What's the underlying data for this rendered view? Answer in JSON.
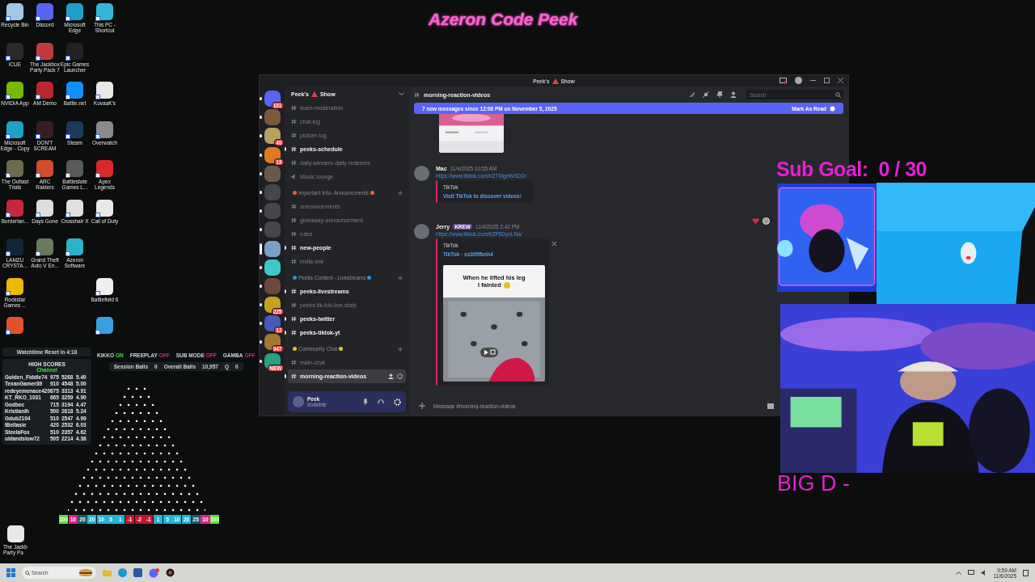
{
  "stream_title": "Azeron Code Peek",
  "desktop_icon_rows": [
    [
      {
        "kind": "app",
        "label": "Recycle Bin",
        "color": "#9fc9e8"
      },
      {
        "kind": "app",
        "label": "Discord",
        "color": "#5865f2"
      },
      {
        "kind": "app",
        "label": "Microsoft Edge",
        "color": "#1fa0c8"
      },
      {
        "kind": "app",
        "label": "This PC - Shortcut",
        "color": "#33b7d6"
      }
    ],
    [
      {
        "kind": "app",
        "label": "iCUE",
        "color": "#2a2a2a"
      },
      {
        "kind": "app",
        "label": "The Jackbox Party Pack 7",
        "color": "#c23a3a"
      },
      {
        "kind": "app",
        "label": "Epic Games Launcher",
        "color": "#222222"
      },
      {
        "kind": "blank"
      }
    ],
    [
      {
        "kind": "app",
        "label": "NVIDIA App",
        "color": "#76b900"
      },
      {
        "kind": "app",
        "label": "AM Demo",
        "color": "#b8282e"
      },
      {
        "kind": "app",
        "label": "Battle.net",
        "color": "#148eff"
      },
      {
        "kind": "app",
        "label": "KovaaK's",
        "color": "#e8e8e8"
      }
    ],
    [
      {
        "kind": "app",
        "label": "Microsoft Edge - Copy",
        "color": "#1fa0c8"
      },
      {
        "kind": "app",
        "label": "DON'T SCREAM",
        "color": "#3a1d22"
      },
      {
        "kind": "app",
        "label": "Steam",
        "color": "#1b3a5c"
      },
      {
        "kind": "app",
        "label": "Overwatch",
        "color": "#8a8a8a"
      }
    ],
    [
      {
        "kind": "app",
        "label": "The Outlast Trials",
        "color": "#6b6a4a"
      },
      {
        "kind": "app",
        "label": "ARC Raiders",
        "color": "#d24b2a"
      },
      {
        "kind": "app",
        "label": "Battlestate Games L...",
        "color": "#5a5a5a"
      },
      {
        "kind": "app",
        "label": "Apex Legends",
        "color": "#da292a"
      }
    ],
    [
      {
        "kind": "app",
        "label": "Borderlan...",
        "color": "#c4283a"
      },
      {
        "kind": "app",
        "label": "Days Gone",
        "color": "#dddddd"
      },
      {
        "kind": "app",
        "label": "Crosshair X",
        "color": "#e0e0e0"
      },
      {
        "kind": "app",
        "label": "Call of Duty",
        "color": "#e8e8e8"
      }
    ],
    [
      {
        "kind": "app",
        "label": "LAMZU CRYSTA...",
        "color": "#12263a"
      },
      {
        "kind": "app",
        "label": "Grand Theft Auto V En...",
        "color": "#6a7a5a"
      },
      {
        "kind": "app",
        "label": "Azeron Software",
        "color": "#2bb3c9"
      },
      {
        "kind": "blank"
      }
    ],
    [
      {
        "kind": "app",
        "label": "Rockstar Games ...",
        "color": "#f2b705"
      },
      {
        "kind": "blank"
      },
      {
        "kind": "blank"
      },
      {
        "kind": "app",
        "label": "Battlefield 6",
        "color": "#eeeeee"
      }
    ],
    [
      {
        "kind": "app",
        "color": "#e3502a"
      },
      {
        "kind": "blank"
      },
      {
        "kind": "blank"
      },
      {
        "kind": "app",
        "color": "#39a0e0"
      }
    ]
  ],
  "corner_icon": {
    "label": "The Jackb Party Pa"
  },
  "plinko": {
    "watchtime": "Watchtime Reset in 4:18",
    "flags": [
      {
        "label": "KIKKO",
        "value": "ON",
        "on": true
      },
      {
        "label": "FREEPLAY",
        "value": "OFF",
        "on": false
      },
      {
        "label": "SUB MODE",
        "value": "OFF",
        "on": false
      },
      {
        "label": "GAMBA",
        "value": "OFF",
        "on": false
      }
    ],
    "stats": [
      {
        "label": "Session Balls",
        "value": "0"
      },
      {
        "label": "Overall Balls",
        "value": "10,957"
      },
      {
        "label": "Q",
        "value": "0"
      }
    ],
    "high_scores": {
      "title": "HIGH SCORES",
      "subtitle": "Channel",
      "rows": [
        [
          "Golden_Fiddle74",
          "975",
          "5268",
          "5.40"
        ],
        [
          "TexanGamer89",
          "910",
          "4548",
          "5.00"
        ],
        [
          "redeyemenace420",
          "675",
          "3313",
          "4.91"
        ],
        [
          "KT_RKO_1031",
          "665",
          "3259",
          "4.90"
        ],
        [
          "Godbec",
          "715",
          "3194",
          "4.47"
        ],
        [
          "KristianIh",
          "500",
          "2618",
          "5.24"
        ],
        [
          "Gdub2104",
          "510",
          "2547",
          "4.99"
        ],
        [
          "IBellasie",
          "420",
          "2532",
          "6.03"
        ],
        [
          "SteelaFox",
          "510",
          "2357",
          "4.62"
        ],
        [
          "oldandslow72",
          "505",
          "2214",
          "4.38"
        ]
      ]
    },
    "bins": [
      {
        "value": "100",
        "color": "#5fe03a"
      },
      {
        "value": "10",
        "color": "#e0238c"
      },
      {
        "value": "20",
        "color": "#1d5a6e"
      },
      {
        "value": "20",
        "color": "#22b5d8"
      },
      {
        "value": "10",
        "color": "#22b5d8"
      },
      {
        "value": "5",
        "color": "#22b5d8"
      },
      {
        "value": "1",
        "color": "#22b5d8"
      },
      {
        "value": "-1",
        "color": "#c4162e"
      },
      {
        "value": "-2",
        "color": "#c4162e"
      },
      {
        "value": "-1",
        "color": "#c4162e"
      },
      {
        "value": "1",
        "color": "#22b5d8"
      },
      {
        "value": "5",
        "color": "#22b5d8"
      },
      {
        "value": "10",
        "color": "#22b5d8"
      },
      {
        "value": "20",
        "color": "#22b5d8"
      },
      {
        "value": "25",
        "color": "#1d5a6e"
      },
      {
        "value": "10",
        "color": "#e0238c"
      },
      {
        "value": "100",
        "color": "#5fe03a"
      }
    ]
  },
  "discord": {
    "window_title": [
      "Peek's",
      "Show"
    ],
    "servers": [
      {
        "badge": "101",
        "color": "#5865f2",
        "selected": false
      },
      {
        "color": "#7a5a3a",
        "selected": false
      },
      {
        "badge": "40",
        "color": "#b8a060",
        "selected": false
      },
      {
        "badge": "19",
        "color": "#e07a20",
        "selected": false
      },
      {
        "color": "#6a5a4a",
        "selected": false
      },
      {
        "color": "#45464c",
        "selected": false
      },
      {
        "color": "#45464c",
        "selected": false
      },
      {
        "color": "#45464c",
        "selected": false
      },
      {
        "color": "#7aa0c8",
        "selected": true
      },
      {
        "color": "#3ec8c8",
        "selected": false
      },
      {
        "color": "#6a4a3a",
        "selected": false
      },
      {
        "badge": "225",
        "color": "#c8a020",
        "selected": false
      },
      {
        "badge": "12",
        "color": "#4a5ab8",
        "selected": false
      },
      {
        "badge": "947",
        "color": "#a07830",
        "selected": false
      },
      {
        "badge": "NEW",
        "color": "#2aa080",
        "selected": false
      }
    ],
    "server_name": [
      "Peek's",
      "Show"
    ],
    "channels": [
      {
        "kind": "text",
        "name": "team-moderation",
        "unread": false,
        "selected": false
      },
      {
        "kind": "text",
        "name": "chat-log",
        "unread": false,
        "selected": false
      },
      {
        "kind": "text",
        "name": "picture-log",
        "unread": false,
        "selected": false
      },
      {
        "kind": "text",
        "name": "peeks-schedule",
        "unread": true,
        "selected": false
      },
      {
        "kind": "text",
        "name": "daily-winners-daily-redeems",
        "unread": false,
        "selected": false
      },
      {
        "kind": "voice",
        "name": "Music lounge",
        "unread": false,
        "selected": false
      },
      {
        "kind": "category",
        "name": "Important Info- Announcments",
        "color": "#e8652b"
      },
      {
        "kind": "text",
        "name": "announcements",
        "unread": false,
        "selected": false
      },
      {
        "kind": "text",
        "name": "giveaway-announcement",
        "unread": false,
        "selected": false
      },
      {
        "kind": "text",
        "name": "rules",
        "unread": false,
        "selected": false
      },
      {
        "kind": "text",
        "name": "new-people",
        "unread": true,
        "selected": false
      },
      {
        "kind": "text",
        "name": "invite-link",
        "unread": false,
        "selected": false
      },
      {
        "kind": "category",
        "name": "Peeks Content - Livestreams",
        "color": "#2f8fd8"
      },
      {
        "kind": "text",
        "name": "peeks-livestreams",
        "unread": true,
        "selected": false
      },
      {
        "kind": "text",
        "name": "peeks-tik-tok-live-stats",
        "unread": false,
        "selected": false
      },
      {
        "kind": "text",
        "name": "peeks-twitter",
        "unread": true,
        "selected": false
      },
      {
        "kind": "text",
        "name": "peeks-tiktok-yt",
        "unread": true,
        "selected": false
      },
      {
        "kind": "category",
        "name": "Community Chat",
        "color": "#e8c32b"
      },
      {
        "kind": "text",
        "name": "main-chat",
        "unread": false,
        "selected": false
      },
      {
        "kind": "text",
        "name": "morning-reaction-videos",
        "unread": true,
        "selected": true
      }
    ],
    "user": {
      "name": "Peek",
      "status": "Invisible"
    },
    "channel_header": "morning-reaction-videos",
    "search": {
      "placeholder": "Search"
    },
    "banner": {
      "text": "7 new messages since 12:08 PM on November 5, 2025",
      "action": "Mark As Read"
    },
    "messages": [
      {
        "author": "Mac",
        "time": "11/4/2025 10:55 AM",
        "link": "https://www.tiktok.com/t/ZTMgeWXDD/",
        "embed": {
          "provider": "TikTok",
          "title": "Visit TikTok to discover videos!"
        }
      },
      {
        "author": "Jerry",
        "tag": "KREW",
        "time": "11/4/2025 2:42 PM",
        "link": "https://www.tiktok.com/t/ZP8DycLNa/",
        "embed": {
          "provider": "TikTok",
          "title": "TikTok · ss305fbnh4",
          "caption": [
            "When he lifted his leg",
            "I fainted"
          ]
        }
      }
    ],
    "composer": {
      "placeholder": "Message #morning-reaction-videos"
    }
  },
  "overlay": {
    "sub_goal": "Sub Goal:  0 / 30",
    "name_tag": "BIG D -"
  },
  "taskbar": {
    "search_placeholder": "Search",
    "time": "9:59 AM",
    "date": "11/6/2025"
  }
}
